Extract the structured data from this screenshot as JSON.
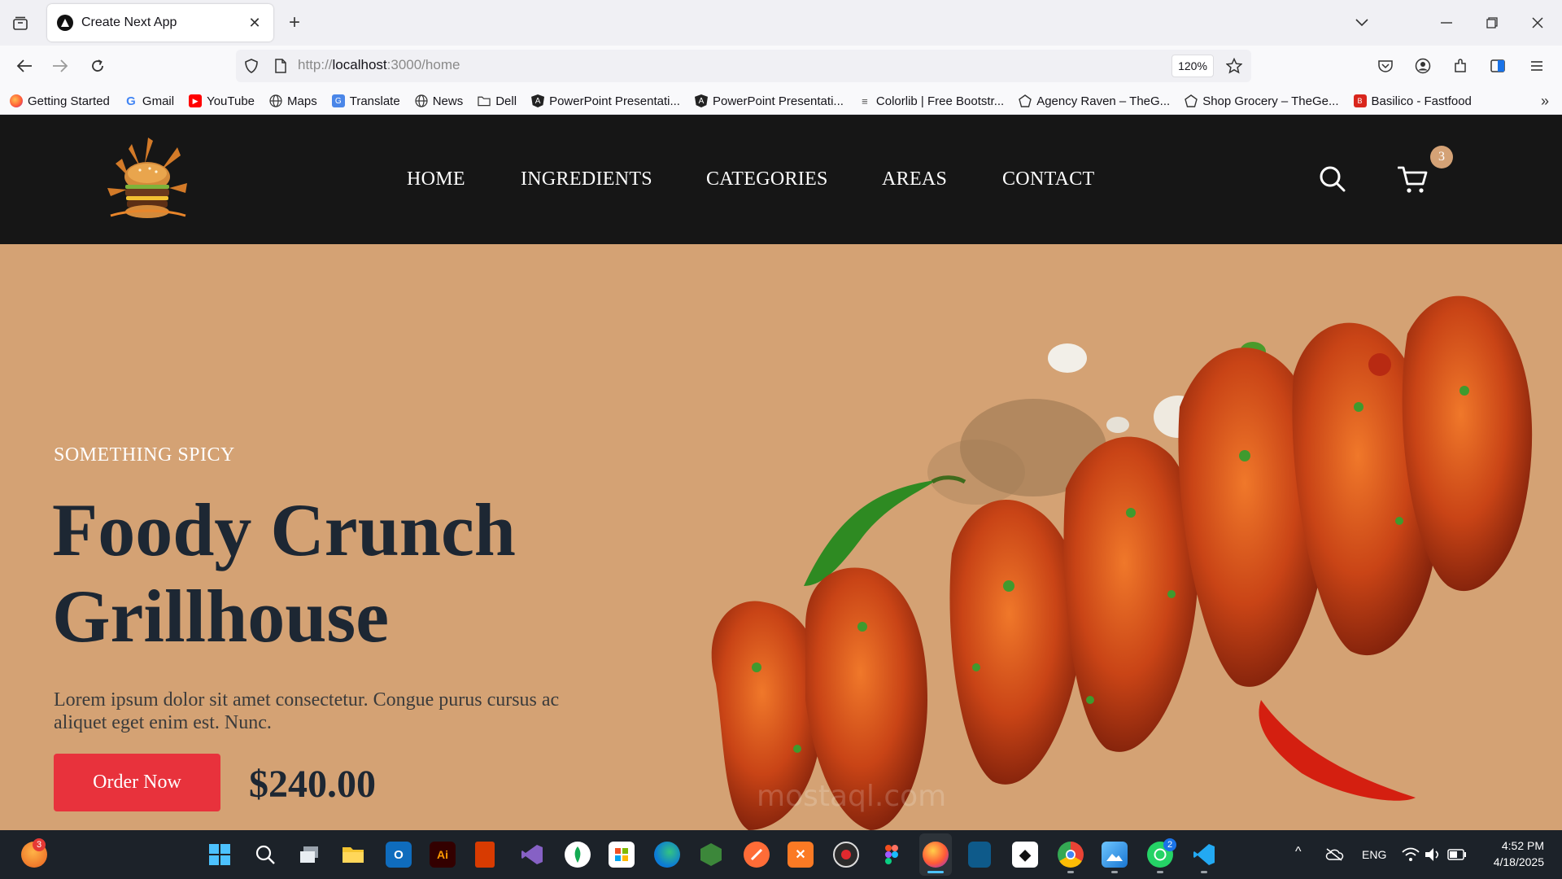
{
  "browser": {
    "tab_title": "Create Next App",
    "url_prefix": "http://",
    "url_host": "localhost",
    "url_rest": ":3000/home",
    "zoom": "120%"
  },
  "bookmarks": [
    {
      "label": "Getting Started",
      "icon": "firefox-icon"
    },
    {
      "label": "Gmail",
      "icon": "google-icon"
    },
    {
      "label": "YouTube",
      "icon": "youtube-icon"
    },
    {
      "label": "Maps",
      "icon": "globe-icon"
    },
    {
      "label": "Translate",
      "icon": "translate-icon"
    },
    {
      "label": "News",
      "icon": "globe-icon"
    },
    {
      "label": "Dell",
      "icon": "folder-icon"
    },
    {
      "label": "PowerPoint Presentati...",
      "icon": "angular-icon"
    },
    {
      "label": "PowerPoint Presentati...",
      "icon": "angular-icon"
    },
    {
      "label": "Colorlib | Free Bootstr...",
      "icon": "colorlib-icon"
    },
    {
      "label": "Agency Raven – TheG...",
      "icon": "pentagon-icon"
    },
    {
      "label": "Shop Grocery – TheGe...",
      "icon": "pentagon-icon"
    },
    {
      "label": "Basilico - Fastfood",
      "icon": "basilico-icon"
    }
  ],
  "site": {
    "nav": [
      "HOME",
      "INGREDIENTS",
      "CATEGORIES",
      "AREAS",
      "CONTACT"
    ],
    "cart_count": "3"
  },
  "hero": {
    "eyebrow": "SOMETHING SPICY",
    "title_line1": "Foody Crunch",
    "title_line2": "Grillhouse",
    "description": "Lorem ipsum dolor sit amet consectetur. Congue purus cursus ac aliquet eget enim est. Nunc.",
    "cta": "Order Now",
    "price": "$240.00",
    "watermark": "mostaql.com"
  },
  "taskbar": {
    "widget_badge": "3",
    "chrome_badge": "",
    "whatsapp_badge": "2",
    "language": "ENG",
    "time": "4:52 PM",
    "date": "4/18/2025"
  },
  "colors": {
    "header_bg": "#161616",
    "hero_bg": "#d4a274",
    "title": "#1d2733",
    "cta": "#e8323c",
    "badge": "#d4a276"
  }
}
